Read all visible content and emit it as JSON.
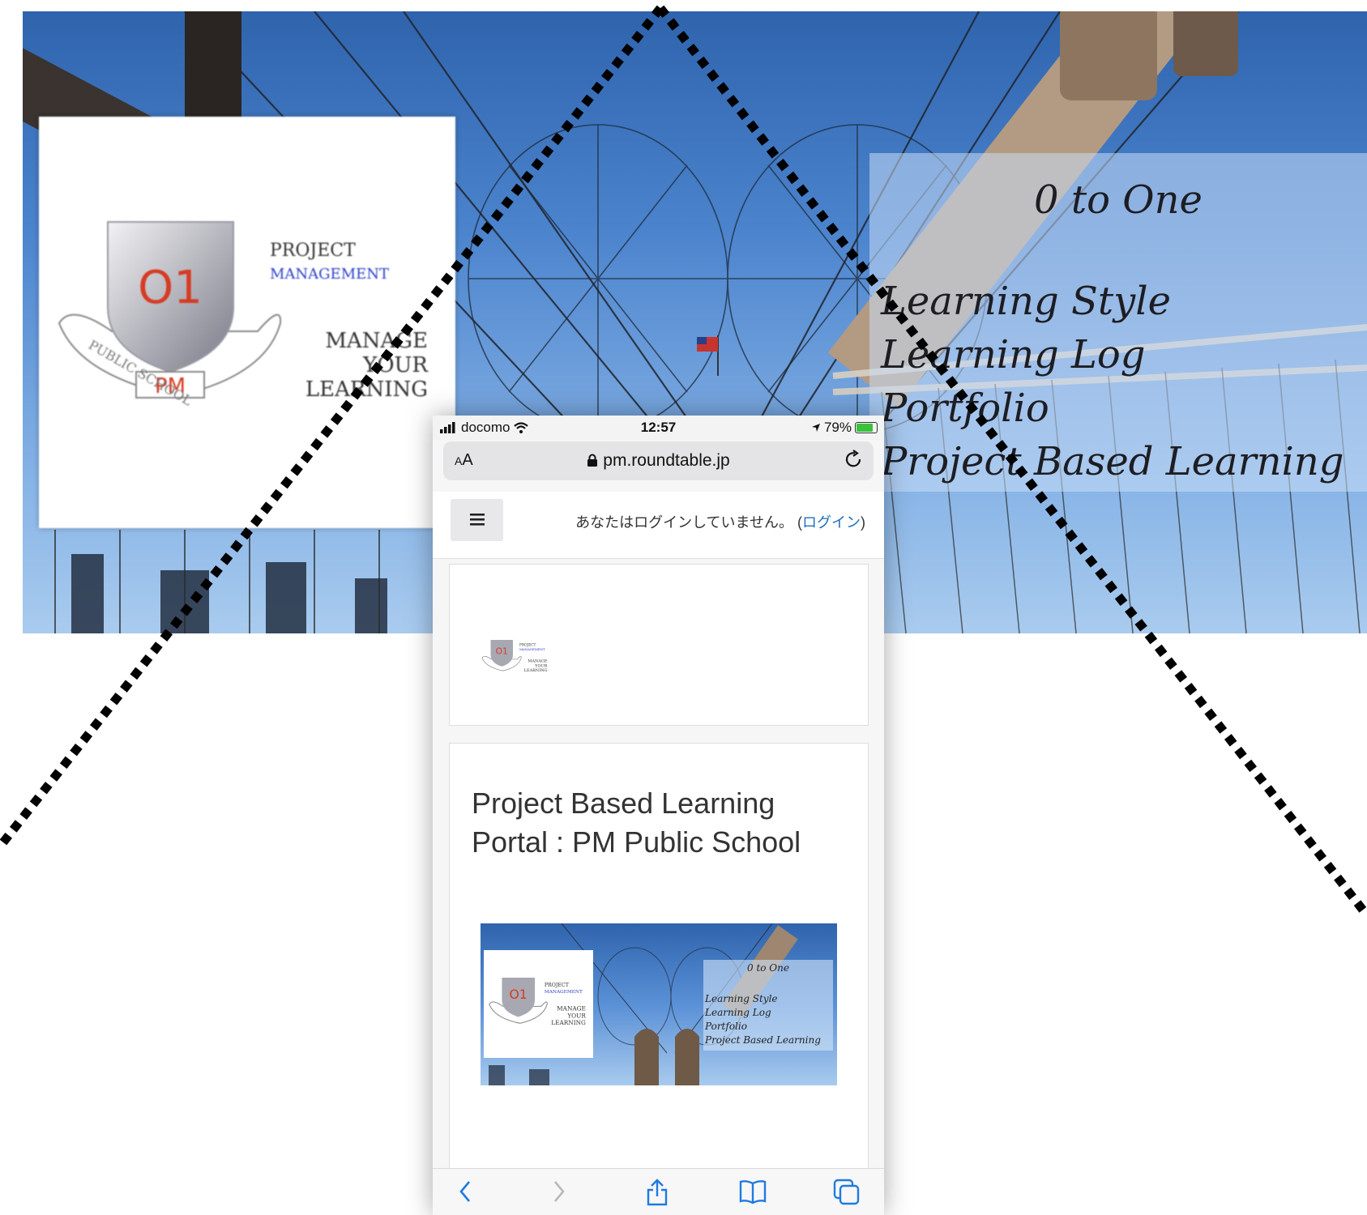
{
  "banner": {
    "logo": {
      "shield_text": "O1",
      "ribbon_text": "PM",
      "arc_text": "PUBLIC SCHOOL",
      "brand_lines": [
        "PROJECT",
        "MANAGEMENT"
      ],
      "tagline": [
        "MANAGE",
        "YOUR",
        "LEARNING"
      ]
    },
    "menu_title": "0 to One",
    "menu_items": [
      "Learning Style",
      "Learning Log",
      "Portfolio",
      "Project Based Learning"
    ]
  },
  "phone": {
    "status": {
      "carrier": "docomo",
      "time": "12:57",
      "battery": "79%"
    },
    "browser": {
      "text_size_label": "AA",
      "url": "pm.roundtable.jp"
    },
    "nav": {
      "login_message": "あなたはログインしていません。",
      "login_link": "ログイン"
    },
    "page": {
      "portal_title": "Project Based Learning Portal : PM Public School"
    }
  },
  "colors": {
    "accent": "#1f6fbd",
    "shield_text": "#d73a22",
    "sky": "#3a73bf"
  }
}
